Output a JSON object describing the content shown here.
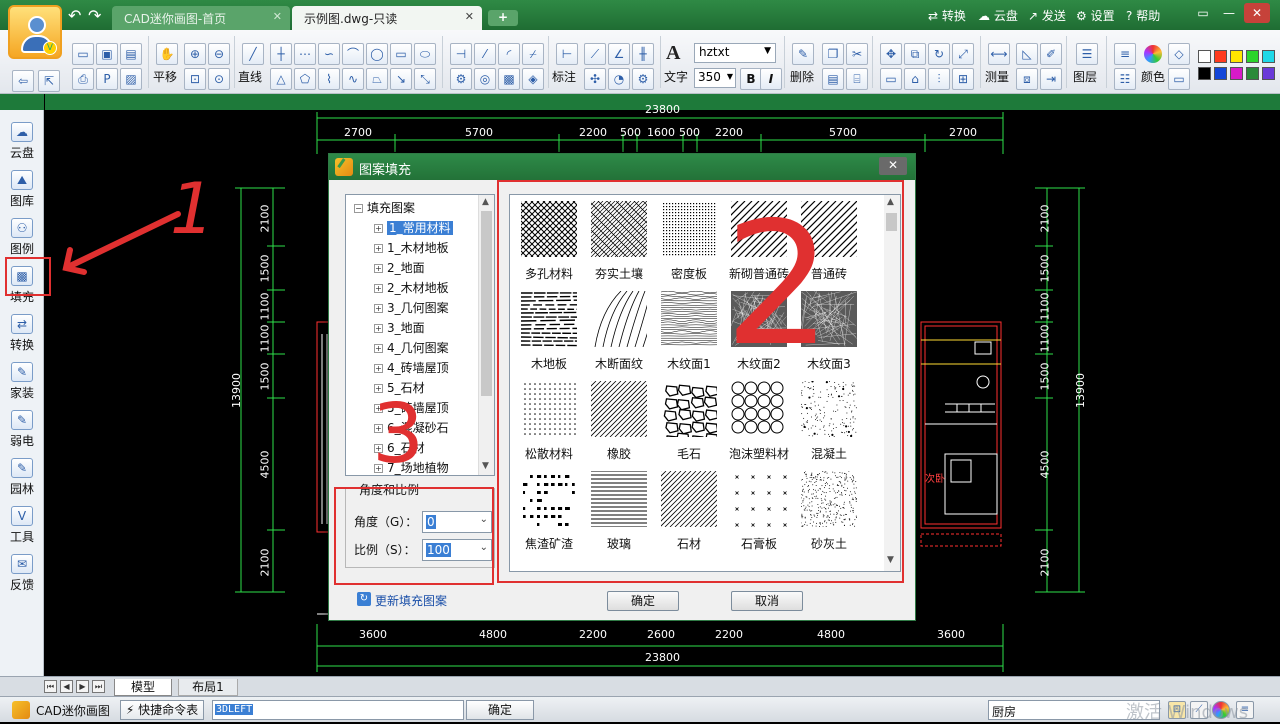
{
  "titlebar": {
    "tabs": [
      {
        "label": "CAD迷你画图-首页"
      },
      {
        "label": "示例图.dwg-只读"
      }
    ],
    "add_tab": "+",
    "menu": {
      "convert": "转换",
      "cloud": "云盘",
      "send": "发送",
      "settings": "设置",
      "help": "帮助"
    }
  },
  "toolbar": {
    "pan_label": "平移",
    "line_label": "直线",
    "annotate_label": "标注",
    "text_label": "文字",
    "delete_label": "删除",
    "measure_label": "测量",
    "layer_label": "图层",
    "color_label": "颜色",
    "font_value": "hztxt",
    "size_value": "350",
    "bold": "B",
    "italic": "I",
    "text_glyph": "A"
  },
  "sidebar": {
    "items": [
      {
        "label": "云盘",
        "icon": "cloud-icon"
      },
      {
        "label": "图库",
        "icon": "gallery-icon"
      },
      {
        "label": "图例",
        "icon": "legend-icon"
      },
      {
        "label": "填充",
        "icon": "hatch-icon"
      },
      {
        "label": "转换",
        "icon": "convert-icon"
      },
      {
        "label": "家装",
        "icon": "home-decor-icon"
      },
      {
        "label": "弱电",
        "icon": "low-voltage-icon"
      },
      {
        "label": "园林",
        "icon": "garden-icon"
      },
      {
        "label": "工具",
        "icon": "tools-icon"
      },
      {
        "label": "反馈",
        "icon": "feedback-icon"
      }
    ]
  },
  "drawing": {
    "top_total": "23800",
    "top_dims": [
      "2700",
      "5700",
      "2200",
      "500",
      "1600",
      "500",
      "2200",
      "5700",
      "2700"
    ],
    "bottom_dims": [
      "3600",
      "4800",
      "2200",
      "2600",
      "2200",
      "4800",
      "3600"
    ],
    "bottom_total": "23800",
    "left_dims": [
      "2100",
      "1500",
      "1100",
      "1100",
      "1500",
      "4500",
      "2100"
    ],
    "left_total": "13900",
    "right_dims": [
      "2100",
      "1500",
      "1100",
      "1100",
      "1500",
      "4500",
      "2100"
    ],
    "right_total": "13900",
    "room_label": "次卧"
  },
  "dialog": {
    "title": "图案填充",
    "tree": {
      "root": "填充图案",
      "children": [
        "1_常用材料",
        "1_木材地板",
        "2_地面",
        "2_木材地板",
        "3_几何图案",
        "3_地面",
        "4_几何图案",
        "4_砖墙屋顶",
        "5_石材",
        "5_砖墙屋顶",
        "6_混凝砂石",
        "6_石材",
        "7_场地植物"
      ]
    },
    "params": {
      "legend": "角度和比例",
      "angle_label": "角度（G）：",
      "angle_value": "0",
      "scale_label": "比例（S）：",
      "scale_value": "100"
    },
    "patterns": [
      {
        "label": "多孔材料",
        "kind": "crosshatch"
      },
      {
        "label": "夯实土壤",
        "kind": "weave"
      },
      {
        "label": "密度板",
        "kind": "dense-dots"
      },
      {
        "label": "新砌普通砖",
        "kind": "diagonal"
      },
      {
        "label": "普通砖",
        "kind": "diagonal"
      },
      {
        "label": "木地板",
        "kind": "wood-floor"
      },
      {
        "label": "木断面纹",
        "kind": "arcs"
      },
      {
        "label": "木纹面1",
        "kind": "grain"
      },
      {
        "label": "木纹面2",
        "kind": "dense-grain"
      },
      {
        "label": "木纹面3",
        "kind": "dense-grain"
      },
      {
        "label": "松散材料",
        "kind": "sparse-dots"
      },
      {
        "label": "橡胶",
        "kind": "diagonal-thin"
      },
      {
        "label": "毛石",
        "kind": "rubble"
      },
      {
        "label": "泡沫塑料材",
        "kind": "circles"
      },
      {
        "label": "混凝土",
        "kind": "speckle"
      },
      {
        "label": "焦渣矿渣",
        "kind": "slag"
      },
      {
        "label": "玻璃",
        "kind": "horizontal"
      },
      {
        "label": "石材",
        "kind": "diagonal-thin"
      },
      {
        "label": "石膏板",
        "kind": "crosses"
      },
      {
        "label": "砂灰土",
        "kind": "speckle-dense"
      }
    ],
    "refresh_link": "更新填充图案",
    "ok": "确定",
    "cancel": "取消"
  },
  "annotations": {
    "one": "1",
    "two": "2",
    "three": "3",
    "color": "#e03030"
  },
  "bottom": {
    "tabs": [
      "模型",
      "布局1"
    ],
    "app_name": "CAD迷你画图",
    "shortcut": "快捷命令表",
    "command_value": "3DLEFT",
    "ok": "确定",
    "room_value": "厨房",
    "watermark": "激活 Windows"
  }
}
